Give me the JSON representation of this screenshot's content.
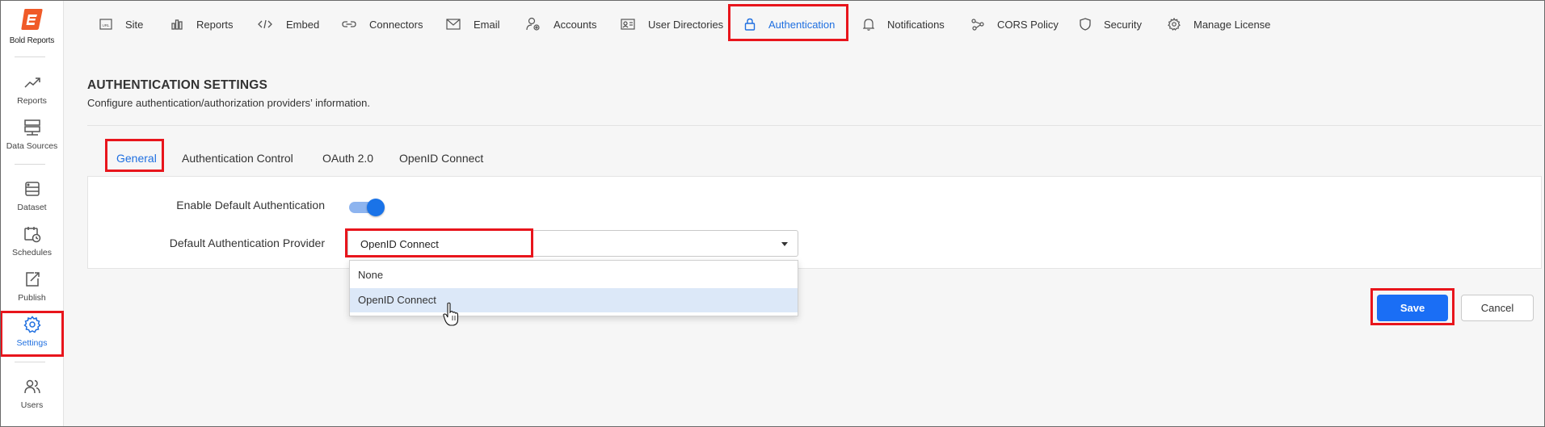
{
  "brand": {
    "name": "Bold Reports",
    "accent": "#1f6fe0",
    "logo_color": "#f05a28"
  },
  "sidebar": {
    "items": [
      {
        "label": "Reports",
        "icon": "trend-line-icon"
      },
      {
        "label": "Data Sources",
        "icon": "server-icon"
      },
      {
        "label": "Dataset",
        "icon": "dataset-icon"
      },
      {
        "label": "Schedules",
        "icon": "calendar-clock-icon"
      },
      {
        "label": "Publish",
        "icon": "publish-icon"
      },
      {
        "label": "Settings",
        "icon": "gear-icon",
        "active": true
      },
      {
        "label": "Users",
        "icon": "users-icon"
      }
    ]
  },
  "topnav": {
    "tabs": [
      {
        "label": "Site",
        "icon": "url-icon"
      },
      {
        "label": "Reports",
        "icon": "bar-chart-icon"
      },
      {
        "label": "Embed",
        "icon": "code-icon"
      },
      {
        "label": "Connectors",
        "icon": "link-icon"
      },
      {
        "label": "Email",
        "icon": "mail-icon"
      },
      {
        "label": "Accounts",
        "icon": "account-icon"
      },
      {
        "label": "User Directories",
        "icon": "id-card-icon"
      },
      {
        "label": "Authentication",
        "icon": "lock-icon",
        "active": true
      },
      {
        "label": "Notifications",
        "icon": "bell-icon"
      },
      {
        "label": "CORS Policy",
        "icon": "share-icon"
      },
      {
        "label": "Security",
        "icon": "shield-icon"
      },
      {
        "label": "Manage License",
        "icon": "license-gear-icon"
      }
    ]
  },
  "page": {
    "title": "AUTHENTICATION SETTINGS",
    "subtitle": "Configure authentication/authorization providers’ information."
  },
  "subtabs": [
    {
      "label": "General",
      "active": true
    },
    {
      "label": "Authentication Control"
    },
    {
      "label": "OAuth 2.0"
    },
    {
      "label": "OpenID Connect"
    }
  ],
  "form": {
    "enable_default_label": "Enable Default Authentication",
    "enable_default_value": true,
    "provider_label": "Default Authentication Provider",
    "provider_value": "OpenID Connect",
    "provider_options": [
      "None",
      "OpenID Connect"
    ],
    "provider_hovered": "OpenID Connect"
  },
  "buttons": {
    "save": "Save",
    "cancel": "Cancel"
  }
}
